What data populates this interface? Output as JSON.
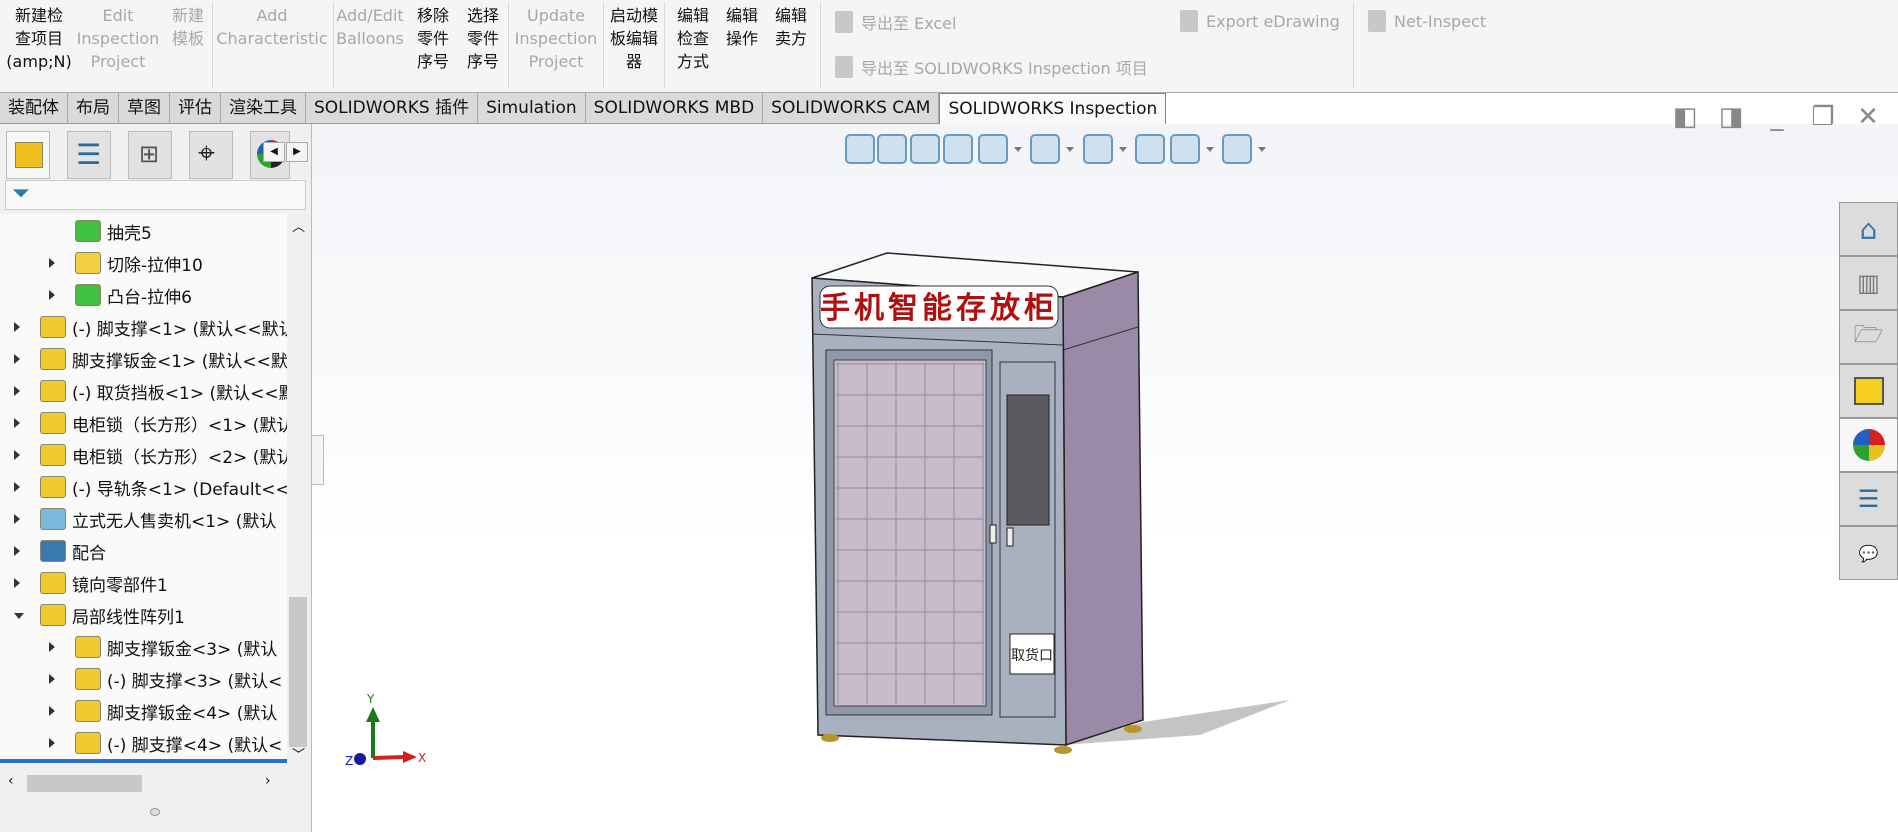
{
  "ribbon": {
    "buttons": [
      {
        "label": "新建检\n查项目\n(amp;N)",
        "enabled": true
      },
      {
        "label": "Edit\nInspection\nProject",
        "enabled": false
      },
      {
        "label": "新建\n模板",
        "enabled": false
      },
      {
        "label": "Add\nCharacteristic",
        "enabled": false
      },
      {
        "label": "Add/Edit\nBalloons",
        "enabled": false
      },
      {
        "label": "移除\n零件\n序号",
        "enabled": true
      },
      {
        "label": "选择\n零件\n序号",
        "enabled": true
      },
      {
        "label": "Update\nInspection\nProject",
        "enabled": false
      },
      {
        "label": "启动模\n板编辑\n器",
        "enabled": true
      },
      {
        "label": "编辑\n检查\n方式",
        "enabled": true
      },
      {
        "label": "编辑\n操作",
        "enabled": true
      },
      {
        "label": "编辑\n卖方",
        "enabled": true
      }
    ],
    "export_excel": "导出至 Excel",
    "export_inspection": "导出至 SOLIDWORKS Inspection 项目",
    "export_edrawing": "Export eDrawing",
    "net_inspect": "Net-Inspect"
  },
  "tabs": [
    "装配体",
    "布局",
    "草图",
    "评估",
    "渲染工具",
    "SOLIDWORKS 插件",
    "Simulation",
    "SOLIDWORKS MBD",
    "SOLIDWORKS CAM",
    "SOLIDWORKS Inspection"
  ],
  "active_tab": "SOLIDWORKS Inspection",
  "tree": [
    {
      "level": 2,
      "expander": "none",
      "icon": "shell-feature-icon",
      "label": "抽壳5"
    },
    {
      "level": 2,
      "expander": "right",
      "icon": "cut-extrude-icon",
      "label": "切除-拉伸10"
    },
    {
      "level": 2,
      "expander": "right",
      "icon": "boss-extrude-icon",
      "label": "凸台-拉伸6"
    },
    {
      "level": 1,
      "expander": "right",
      "icon": "part-icon",
      "label": "(-) 脚支撑<1> (默认<<默认"
    },
    {
      "level": 1,
      "expander": "right",
      "icon": "part-icon",
      "label": "脚支撑钣金<1> (默认<<默"
    },
    {
      "level": 1,
      "expander": "right",
      "icon": "part-icon",
      "label": "(-) 取货挡板<1> (默认<<默"
    },
    {
      "level": 1,
      "expander": "right",
      "icon": "part-icon",
      "label": "电柜锁（长方形）<1> (默认"
    },
    {
      "level": 1,
      "expander": "right",
      "icon": "part-icon",
      "label": "电柜锁（长方形）<2> (默认"
    },
    {
      "level": 1,
      "expander": "right",
      "icon": "part-icon",
      "label": "(-) 导轨条<1> (Default<<"
    },
    {
      "level": 1,
      "expander": "right",
      "icon": "subassembly-icon",
      "label": "立式无人售卖机<1> (默认"
    },
    {
      "level": 1,
      "expander": "right",
      "icon": "mates-icon",
      "label": "配合"
    },
    {
      "level": 1,
      "expander": "right",
      "icon": "mirror-component-icon",
      "label": "镜向零部件1"
    },
    {
      "level": 1,
      "expander": "down",
      "icon": "linear-pattern-icon",
      "label": "局部线性阵列1"
    },
    {
      "level": 2,
      "expander": "right",
      "icon": "part-icon",
      "label": "脚支撑钣金<3> (默认"
    },
    {
      "level": 2,
      "expander": "right",
      "icon": "part-icon",
      "label": "(-) 脚支撑<3> (默认<"
    },
    {
      "level": 2,
      "expander": "right",
      "icon": "part-icon",
      "label": "脚支撑钣金<4> (默认"
    },
    {
      "level": 2,
      "expander": "right",
      "icon": "part-icon",
      "label": "(-) 脚支撑<4> (默认<"
    }
  ],
  "model": {
    "sign_text": "手机智能存放柜",
    "pickup_label": "取货口"
  },
  "triad": {
    "x": "X",
    "y": "Y",
    "z": "Z"
  },
  "colors": {
    "accent_blue": "#2a6fc9",
    "sign_red": "#b01010",
    "cabinet_side": "#9a8aa8",
    "cabinet_front": "#a9b0c0"
  }
}
